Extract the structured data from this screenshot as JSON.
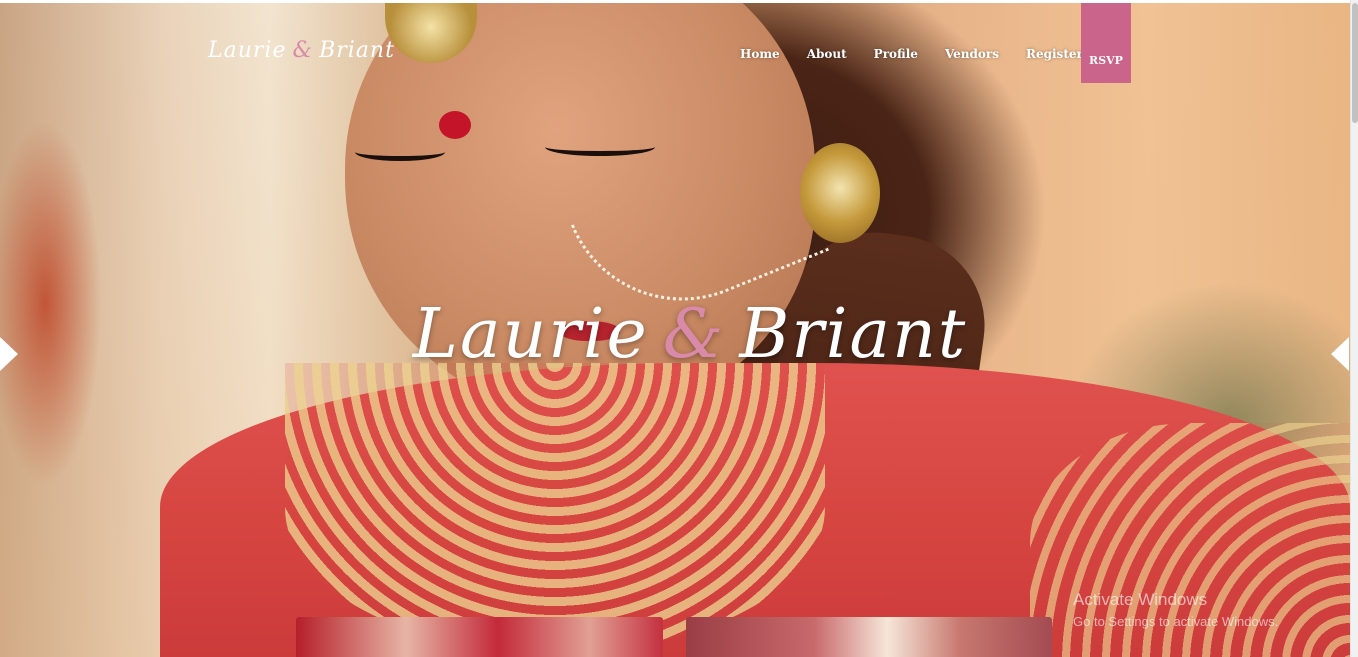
{
  "brand": {
    "first": "Laurie",
    "amp": "&",
    "second": "Briant"
  },
  "nav": {
    "items": [
      "Home",
      "About",
      "Profile",
      "Vendors",
      "Register"
    ],
    "rsvp": "RSVP"
  },
  "hero": {
    "title_first": "Laurie",
    "title_amp": "&",
    "title_second": "Briant"
  },
  "watermark": {
    "line1": "Activate Windows",
    "line2": "Go to Settings to activate Windows."
  },
  "colors": {
    "accent": "#c9608a",
    "ampersand": "#d98aa9",
    "text": "#ffffff"
  },
  "icons": {
    "prev": "chevron-left-icon",
    "next": "chevron-right-icon"
  }
}
